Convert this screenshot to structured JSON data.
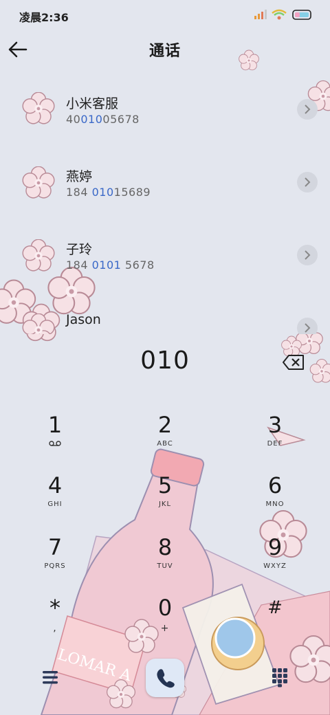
{
  "status": {
    "time": "凌晨2:36",
    "icons": [
      "signal-icon",
      "wifi-icon",
      "battery-icon"
    ]
  },
  "header": {
    "title": "通话",
    "back_icon": "arrow-left-icon"
  },
  "contacts": [
    {
      "name": "小米客服",
      "num_pre": "40",
      "num_hl": "010",
      "num_post": "05678"
    },
    {
      "name": "燕婷",
      "num_pre": "184 ",
      "num_hl": "010",
      "num_post": "15689"
    },
    {
      "name": "子玲",
      "num_pre": "184 ",
      "num_hl": "0101",
      "num_post": " 5678"
    },
    {
      "name": "Jason",
      "num_pre": "",
      "num_hl": "",
      "num_post": ""
    }
  ],
  "dial": {
    "input": "010"
  },
  "keys": [
    {
      "digit": "1",
      "letters": ""
    },
    {
      "digit": "2",
      "letters": "ABC"
    },
    {
      "digit": "3",
      "letters": "DEF"
    },
    {
      "digit": "4",
      "letters": "GHI"
    },
    {
      "digit": "5",
      "letters": "JKL"
    },
    {
      "digit": "6",
      "letters": "MNO"
    },
    {
      "digit": "7",
      "letters": "PQRS"
    },
    {
      "digit": "8",
      "letters": "TUV"
    },
    {
      "digit": "9",
      "letters": "WXYZ"
    },
    {
      "digit": "*",
      "letters": ","
    },
    {
      "digit": "0",
      "letters": "+"
    },
    {
      "digit": "#",
      "letters": ""
    }
  ],
  "bottom": {
    "menu_icon": "menu-icon",
    "call_icon": "phone-icon",
    "keypad_icon": "keypad-icon"
  },
  "colors": {
    "background": "#e3e6ee",
    "highlight": "#3a68c8",
    "blossom": "#f6e1e5",
    "blossom_line": "#b88a96"
  },
  "wallpaper_text": "LOMAR A"
}
